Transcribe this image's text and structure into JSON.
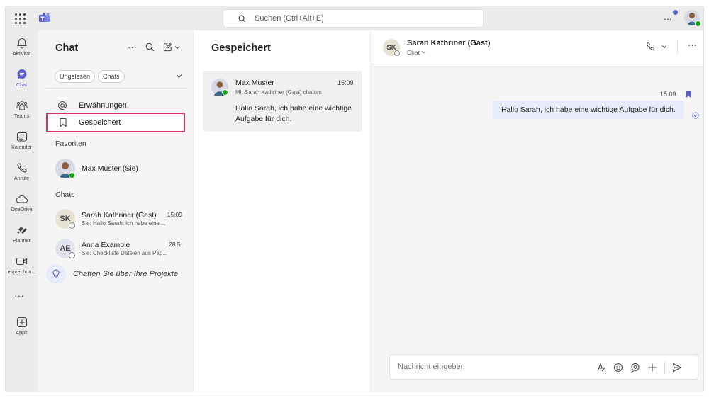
{
  "topbar": {
    "search_placeholder": "Suchen (Ctrl+Alt+E)",
    "more": "..."
  },
  "rail": {
    "items": [
      {
        "label": "Aktivität",
        "icon": "bell-icon"
      },
      {
        "label": "Chat",
        "icon": "chat-icon",
        "active": true
      },
      {
        "label": "Teams",
        "icon": "teams-icon"
      },
      {
        "label": "Kalender",
        "icon": "calendar-icon"
      },
      {
        "label": "Anrufe",
        "icon": "phone-icon"
      },
      {
        "label": "OneDrive",
        "icon": "cloud-icon"
      },
      {
        "label": "Planner",
        "icon": "planner-icon"
      },
      {
        "label": "esprechun...",
        "icon": "video-icon"
      },
      {
        "label": "Apps",
        "icon": "add-apps-icon"
      }
    ],
    "more": "···"
  },
  "chatlist": {
    "title": "Chat",
    "more": "···",
    "filters": [
      "Ungelesen",
      "Chats"
    ],
    "nav": {
      "mentions": "Erwähnungen",
      "saved": "Gespeichert"
    },
    "favorites_header": "Favoriten",
    "favorite": {
      "name": "Max Muster (Sie)"
    },
    "chats_header": "Chats",
    "chats": [
      {
        "initials": "SK",
        "name": "Sarah Kathriner (Gast)",
        "time": "15:09",
        "preview": "Sie: Hallo Sarah, ich habe eine ..."
      },
      {
        "initials": "AE",
        "name": "Anna Example",
        "time": "28.5.",
        "preview": "Sie: Checkliste Dateien aus Pap..."
      }
    ],
    "tip": "Chatten Sie über Ihre Projekte"
  },
  "saved": {
    "title": "Gespeichert",
    "card": {
      "name": "Max Muster",
      "time": "15:09",
      "subtitle": "Mit Sarah Kathriner (Gast) chatten",
      "message": "Hallo Sarah, ich habe eine wichtige Aufgabe für dich."
    }
  },
  "conversation": {
    "initials": "SK",
    "name": "Sarah Kathriner (Gast)",
    "subtitle": "Chat",
    "more": "···",
    "message": {
      "time": "15:09",
      "text": "Hallo Sarah, ich habe eine wichtige Aufgabe für dich."
    },
    "composer_placeholder": "Nachricht eingeben"
  },
  "colors": {
    "accent": "#5b5fc7",
    "highlight_border": "#d0345f",
    "presence_available": "#13a10e",
    "bubble": "#e8ebfa"
  }
}
